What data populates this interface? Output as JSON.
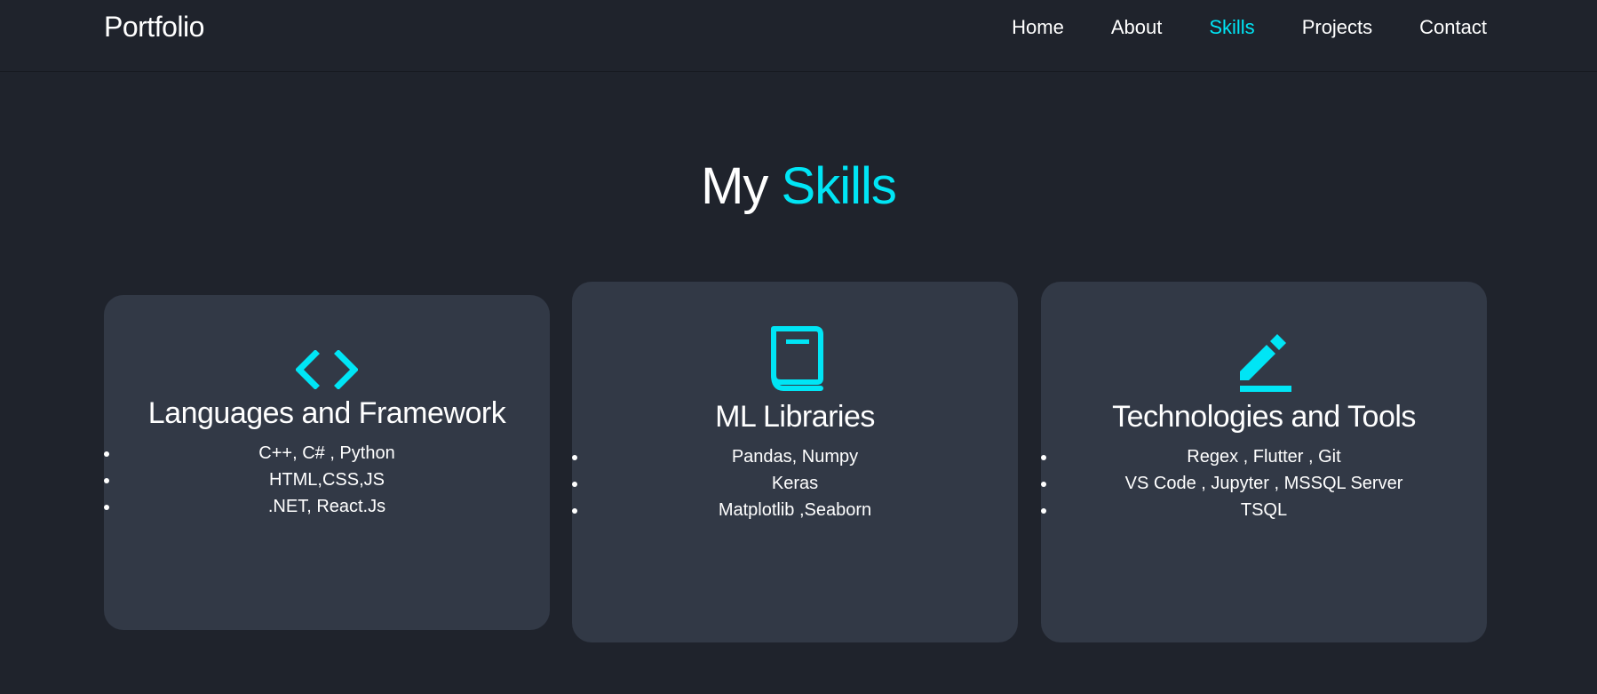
{
  "nav": {
    "brand": "Portfolio",
    "links": [
      {
        "label": "Home"
      },
      {
        "label": "About"
      },
      {
        "label": "Skills"
      },
      {
        "label": "Projects"
      },
      {
        "label": "Contact"
      }
    ],
    "active": "Skills"
  },
  "section": {
    "title_prefix": "My",
    "title_accent": "Skills"
  },
  "cards": [
    {
      "icon": "code-brackets-icon",
      "title": "Languages and Framework",
      "items": [
        "C++, C# , Python",
        "HTML,CSS,JS",
        ".NET, React.Js"
      ]
    },
    {
      "icon": "book-icon",
      "title": "ML Libraries",
      "items": [
        "Pandas, Numpy",
        "Keras",
        "Matplotlib ,Seaborn"
      ]
    },
    {
      "icon": "pencil-icon",
      "title": "Technologies and Tools",
      "items": [
        "Regex , Flutter , Git",
        "VS Code , Jupyter , MSSQL Server",
        "TSQL"
      ]
    }
  ],
  "colors": {
    "background": "#1f232c",
    "card": "#323946",
    "accent": "#00e5f5",
    "text": "#ffffff"
  }
}
